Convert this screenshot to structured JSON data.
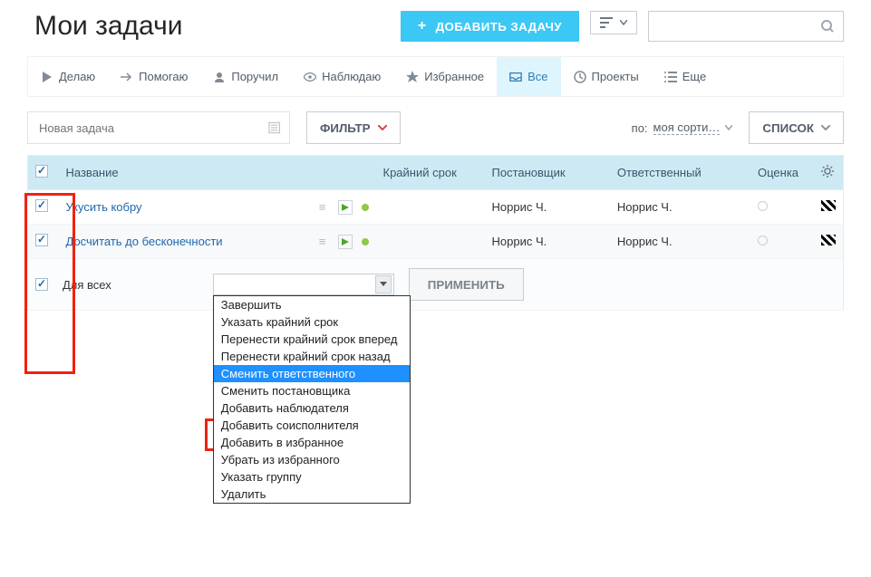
{
  "header": {
    "title": "Мои задачи",
    "add_button": "ДОБАВИТЬ ЗАДАЧУ"
  },
  "tabs": [
    {
      "id": "doing",
      "label": "Делаю",
      "icon": "play"
    },
    {
      "id": "helping",
      "label": "Помогаю",
      "icon": "arrow"
    },
    {
      "id": "assigned",
      "label": "Поручил",
      "icon": "person"
    },
    {
      "id": "watching",
      "label": "Наблюдаю",
      "icon": "eye"
    },
    {
      "id": "favorites",
      "label": "Избранное",
      "icon": "star"
    },
    {
      "id": "all",
      "label": "Все",
      "icon": "inbox",
      "active": true
    },
    {
      "id": "projects",
      "label": "Проекты",
      "icon": "clock"
    },
    {
      "id": "more",
      "label": "Еще",
      "icon": "list"
    }
  ],
  "toolbar": {
    "new_task_placeholder": "Новая задача",
    "filter_label": "ФИЛЬТР",
    "sort_label_prefix": "по:",
    "sort_value": "моя сорти…",
    "view_label": "СПИСОК"
  },
  "grid": {
    "select_all_checked": true,
    "columns": {
      "title": "Название",
      "deadline": "Крайний срок",
      "creator": "Постановщик",
      "responsible": "Ответственный",
      "estimate": "Оценка"
    },
    "rows": [
      {
        "checked": true,
        "title": "Укусить кобру",
        "deadline": "",
        "creator": "Норрис Ч.",
        "responsible": "Норрис Ч."
      },
      {
        "checked": true,
        "title": "Досчитать до бесконечности",
        "deadline": "",
        "creator": "Норрис Ч.",
        "responsible": "Норрис Ч."
      }
    ]
  },
  "batch": {
    "all_label": "Для всех",
    "all_checked": true,
    "apply_label": "ПРИМЕНИТЬ",
    "options": [
      "Завершить",
      "Указать крайний срок",
      "Перенести крайний срок вперед",
      "Перенести крайний срок назад",
      "Сменить ответственного",
      "Сменить постановщика",
      "Добавить наблюдателя",
      "Добавить соисполнителя",
      "Добавить в избранное",
      "Убрать из избранного",
      "Указать группу",
      "Удалить"
    ],
    "selected_index": 4
  }
}
